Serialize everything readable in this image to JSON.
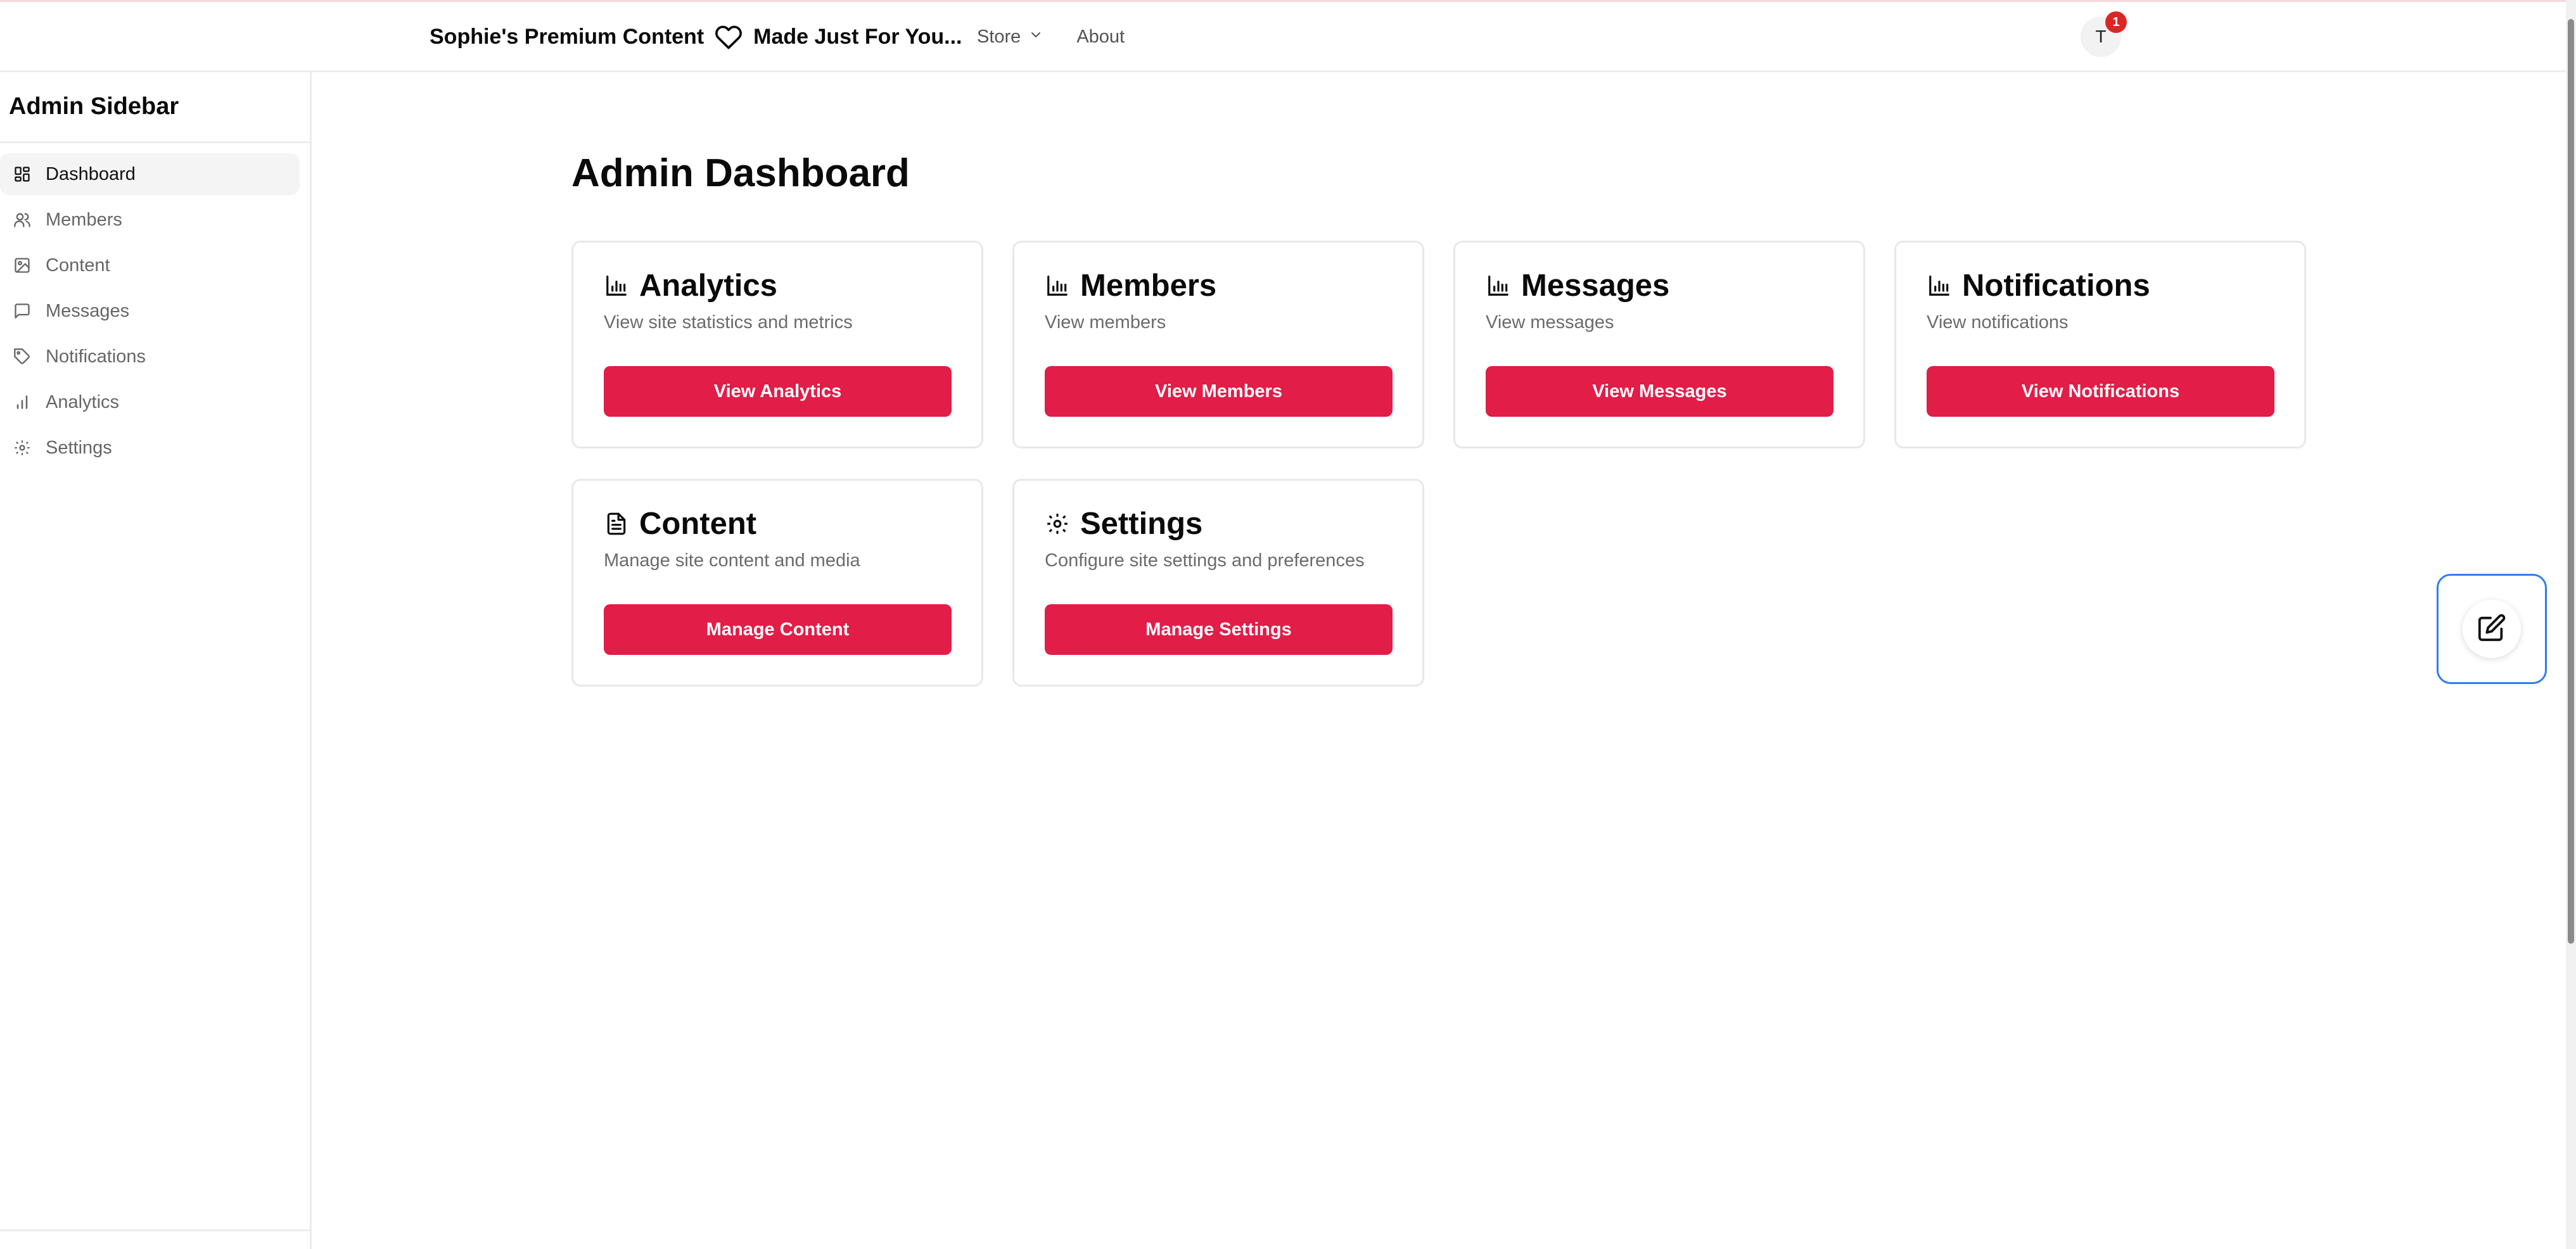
{
  "header": {
    "brand_left": "Sophie's Premium Content",
    "brand_right": "Made Just For You...",
    "nav": [
      {
        "label": "Store",
        "has_dropdown": true
      },
      {
        "label": "About",
        "has_dropdown": false
      }
    ],
    "avatar_initial": "T",
    "notification_count": "1"
  },
  "sidebar": {
    "title": "Admin Sidebar",
    "items": [
      {
        "label": "Dashboard",
        "icon": "dashboard-icon",
        "active": true
      },
      {
        "label": "Members",
        "icon": "users-icon",
        "active": false
      },
      {
        "label": "Content",
        "icon": "image-icon",
        "active": false
      },
      {
        "label": "Messages",
        "icon": "message-icon",
        "active": false
      },
      {
        "label": "Notifications",
        "icon": "tag-icon",
        "active": false
      },
      {
        "label": "Analytics",
        "icon": "bar-chart-icon",
        "active": false
      },
      {
        "label": "Settings",
        "icon": "gear-icon",
        "active": false
      }
    ]
  },
  "main": {
    "title": "Admin Dashboard",
    "cards": [
      {
        "title": "Analytics",
        "description": "View site statistics and metrics",
        "button": "View Analytics",
        "icon": "bar-chart-icon"
      },
      {
        "title": "Members",
        "description": "View members",
        "button": "View Members",
        "icon": "bar-chart-icon"
      },
      {
        "title": "Messages",
        "description": "View messages",
        "button": "View Messages",
        "icon": "bar-chart-icon"
      },
      {
        "title": "Notifications",
        "description": "View notifications",
        "button": "View Notifications",
        "icon": "bar-chart-icon"
      },
      {
        "title": "Content",
        "description": "Manage site content and media",
        "button": "Manage Content",
        "icon": "document-icon"
      },
      {
        "title": "Settings",
        "description": "Configure site settings and preferences",
        "button": "Manage Settings",
        "icon": "gear-icon"
      }
    ]
  },
  "floating_action": {
    "icon": "edit-icon"
  },
  "colors": {
    "accent": "#e11d48",
    "badge": "#dc2626",
    "focus_ring": "#2f7ee8"
  }
}
